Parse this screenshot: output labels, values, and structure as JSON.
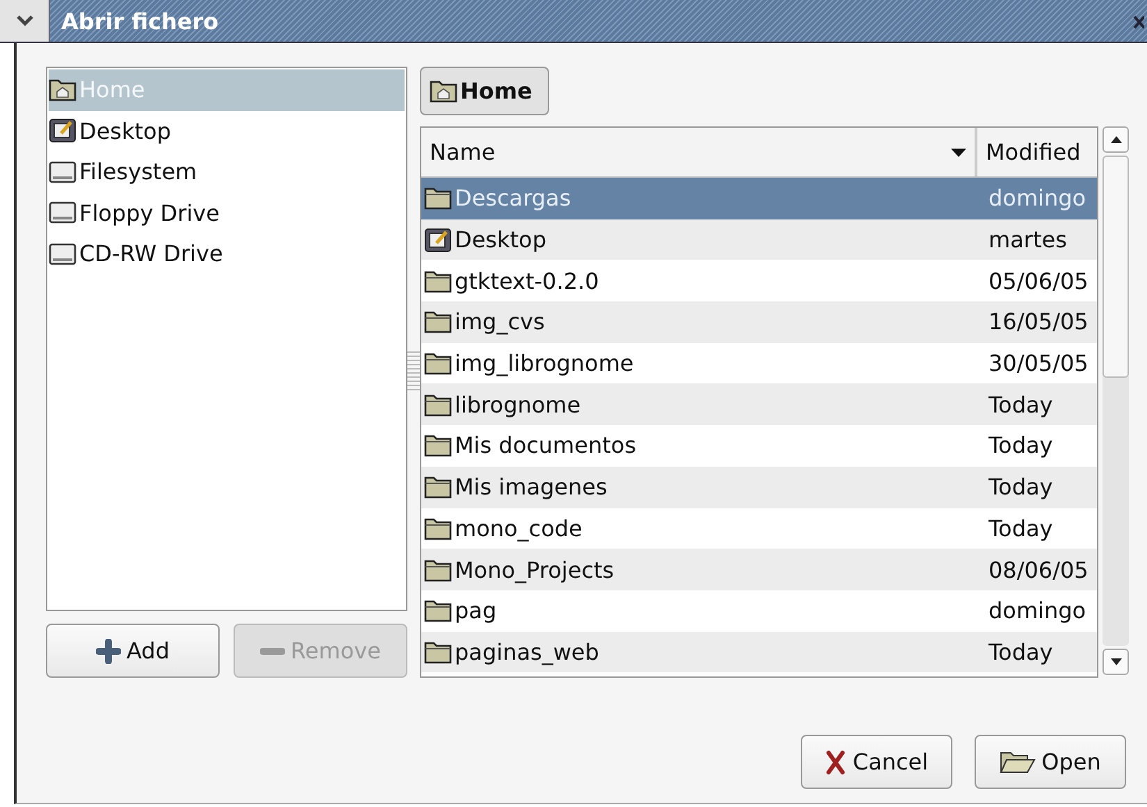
{
  "window": {
    "title": "Abrir fichero"
  },
  "places": [
    {
      "label": "Home",
      "kind": "home",
      "selected": true
    },
    {
      "label": "Desktop",
      "kind": "desktop",
      "selected": false
    },
    {
      "label": "Filesystem",
      "kind": "drive",
      "selected": false
    },
    {
      "label": "Floppy Drive",
      "kind": "drive",
      "selected": false
    },
    {
      "label": "CD-RW Drive",
      "kind": "drive",
      "selected": false
    }
  ],
  "place_buttons": [
    {
      "label": "Add",
      "kind": "add",
      "disabled": false
    },
    {
      "label": "Remove",
      "kind": "remove",
      "disabled": true
    }
  ],
  "path_button": {
    "label": "Home"
  },
  "table": {
    "columns": [
      "Name",
      "Modified"
    ],
    "rows": [
      {
        "name": "Descargas",
        "modified": "domingo",
        "kind": "folder",
        "selected": true
      },
      {
        "name": "Desktop",
        "modified": "martes",
        "kind": "desktop",
        "selected": false
      },
      {
        "name": "gtktext-0.2.0",
        "modified": "05/06/05",
        "kind": "folder",
        "selected": false
      },
      {
        "name": "img_cvs",
        "modified": "16/05/05",
        "kind": "folder",
        "selected": false
      },
      {
        "name": "img_librognome",
        "modified": "30/05/05",
        "kind": "folder",
        "selected": false
      },
      {
        "name": "librognome",
        "modified": "Today",
        "kind": "folder",
        "selected": false
      },
      {
        "name": "Mis documentos",
        "modified": "Today",
        "kind": "folder",
        "selected": false
      },
      {
        "name": "Mis imagenes",
        "modified": "Today",
        "kind": "folder",
        "selected": false
      },
      {
        "name": "mono_code",
        "modified": "Today",
        "kind": "folder",
        "selected": false
      },
      {
        "name": "Mono_Projects",
        "modified": "08/06/05",
        "kind": "folder",
        "selected": false
      },
      {
        "name": "pag",
        "modified": "domingo",
        "kind": "folder",
        "selected": false
      },
      {
        "name": "paginas_web",
        "modified": "Today",
        "kind": "folder",
        "selected": false
      }
    ]
  },
  "buttons": [
    {
      "label": "Cancel",
      "kind": "cancel"
    },
    {
      "label": "Open",
      "kind": "open"
    }
  ]
}
